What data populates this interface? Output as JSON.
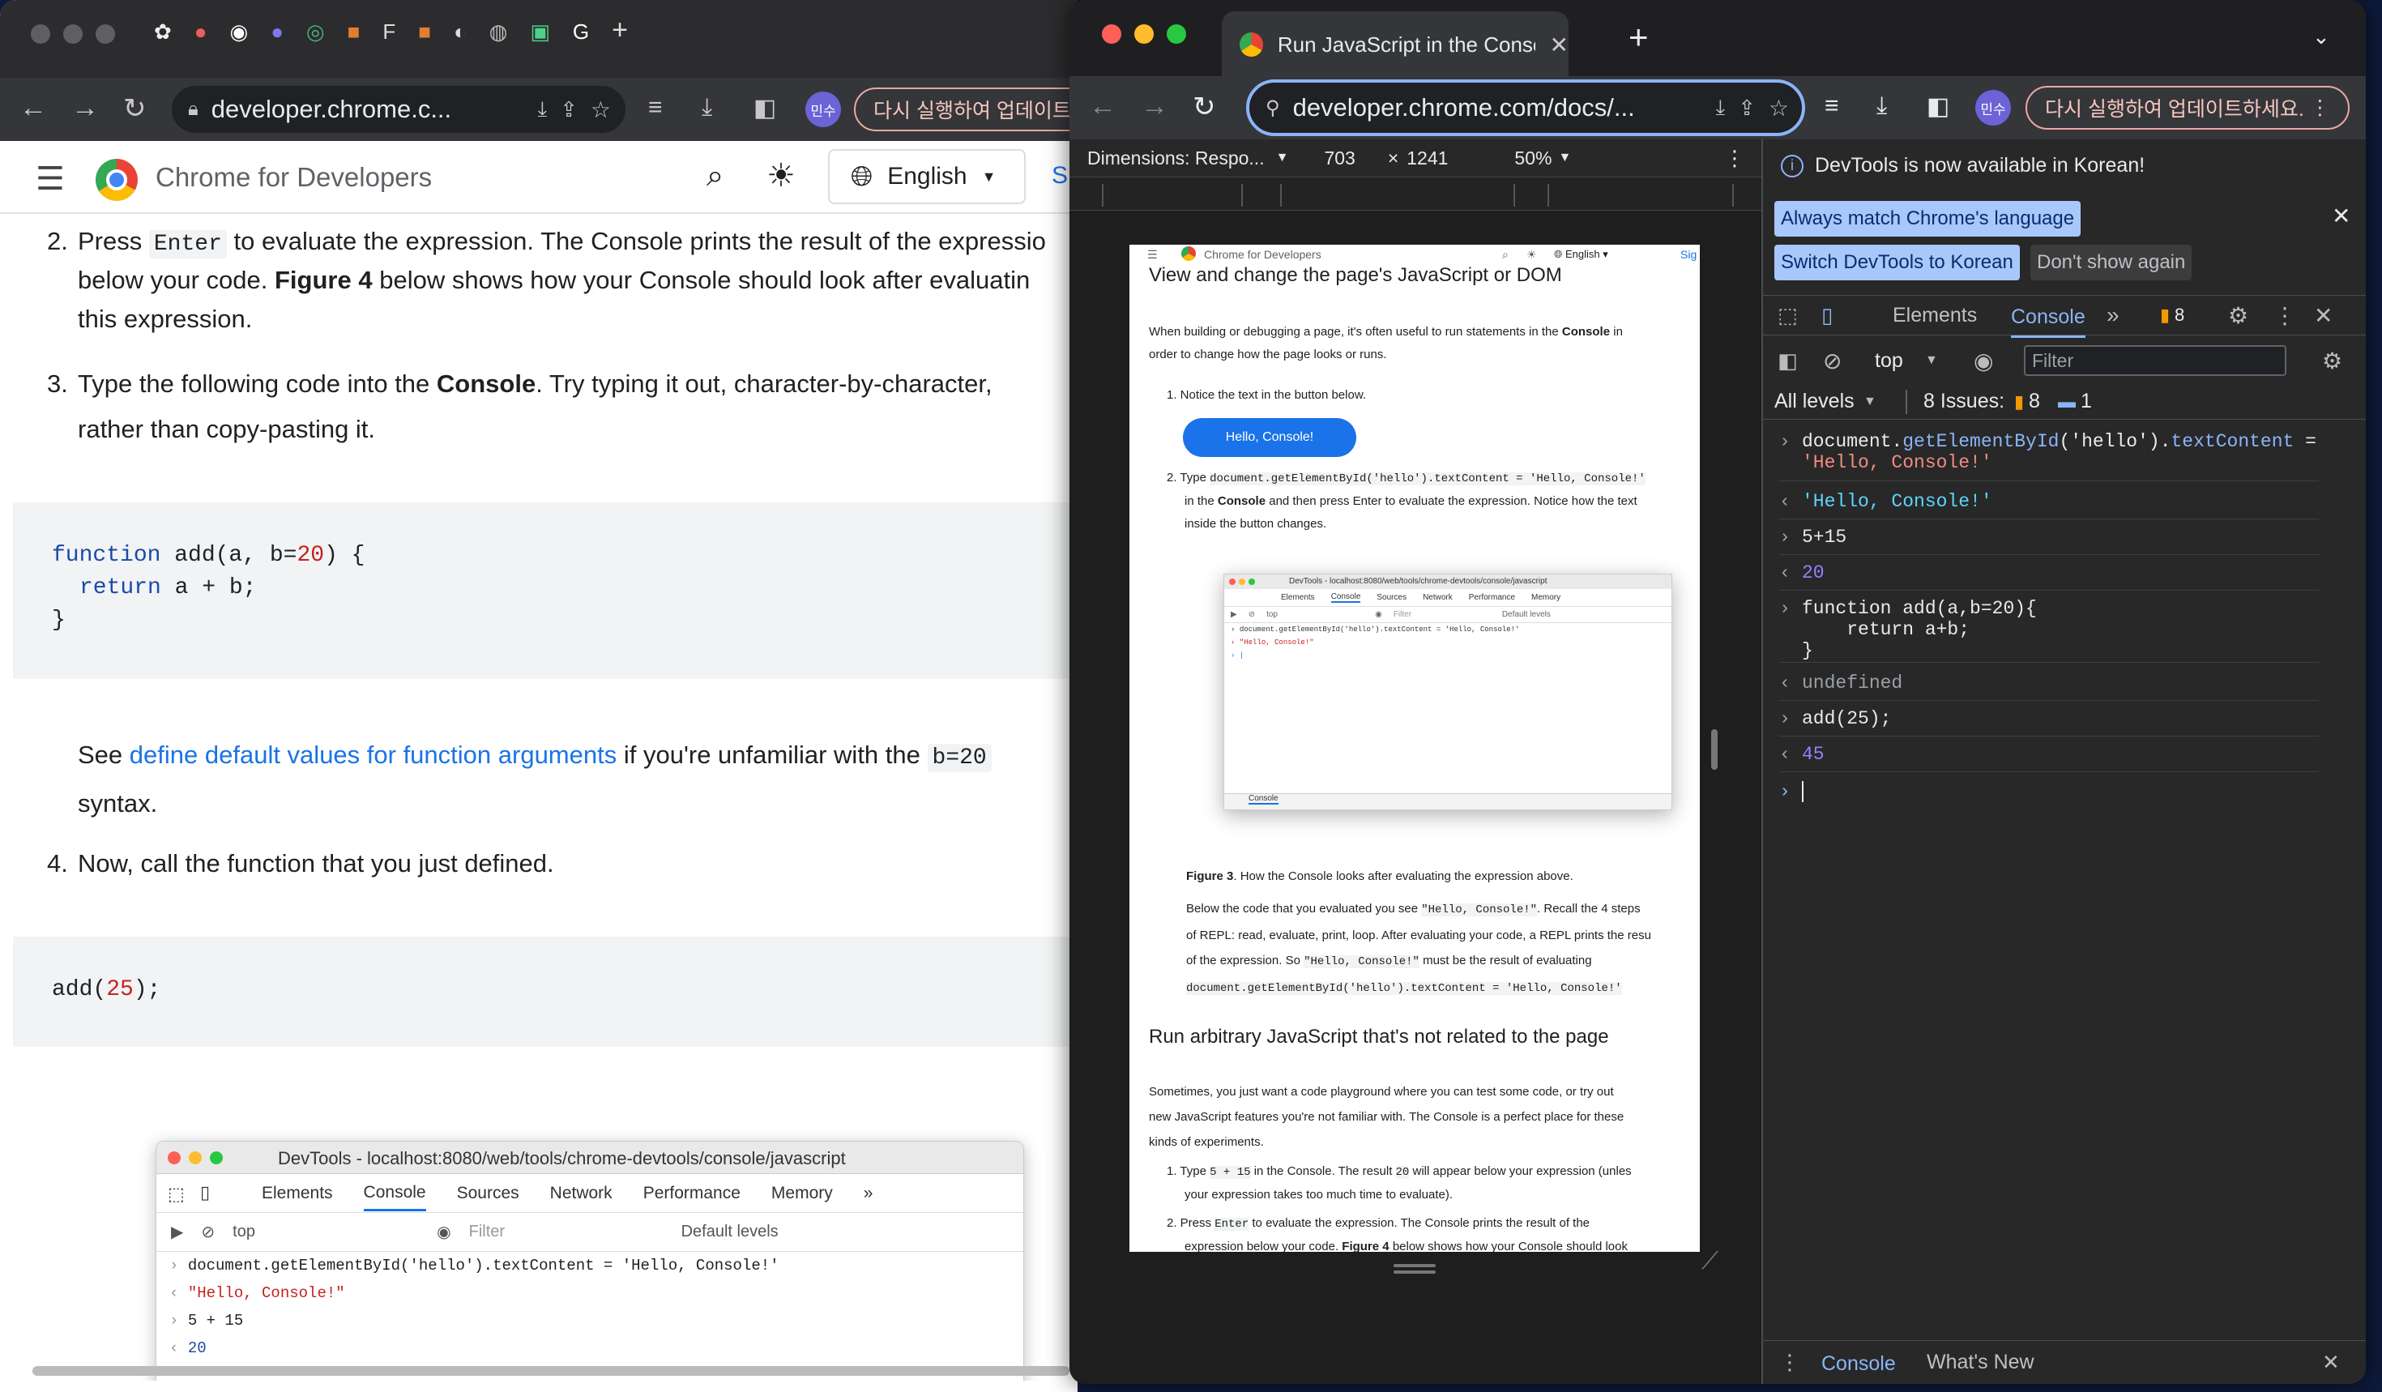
{
  "left_window": {
    "address": "developer.chrome.c...",
    "relaunch": "다시 실행하여 업데이트",
    "avatar": "민수",
    "site_name": "Chrome for Developers",
    "language": "English",
    "signin_partial": "Si",
    "step2": {
      "num": "2.",
      "pre": "Press",
      "code": "Enter",
      "post": "to evaluate the expression. The Console prints the result of the expressio",
      "line2a": "below your code.",
      "fig": "Figure 4",
      "line2b": "below shows how your Console should look after evaluatin",
      "line3": "this expression."
    },
    "step3": {
      "num": "3.",
      "pre": "Type the following code into the",
      "bold": "Console",
      "post": ". Try typing it out, character-by-character,",
      "line2": "rather than copy-pasting it."
    },
    "code1": {
      "l1_kw": "function",
      "l1_a": " add(a, b=",
      "l1_num": "20",
      "l1_b": ") {",
      "l2_kw": "return",
      "l2_rest": " a + b;",
      "l3": "}"
    },
    "see": {
      "pre": "See",
      "link": "define default values for function arguments",
      "mid": "if you're unfamiliar with the",
      "code": "b=20",
      "post": "syntax."
    },
    "step4": {
      "num": "4.",
      "text": "Now, call the function that you just defined."
    },
    "code2": {
      "a": "add(",
      "num": "25",
      "b": ");"
    },
    "fig_window": {
      "title": "DevTools - localhost:8080/web/tools/chrome-devtools/console/javascript",
      "tabs": [
        "Elements",
        "Console",
        "Sources",
        "Network",
        "Performance",
        "Memory"
      ],
      "context": "top",
      "filter_placeholder": "Filter",
      "levels": "Default levels",
      "lines": [
        "document.getElementById('hello').textContent = 'Hello, Console!'",
        "\"Hello, Console!\"",
        "5 + 15",
        "20"
      ]
    }
  },
  "right_window": {
    "tab_title": "Run JavaScript in the Console",
    "address": "developer.chrome.com/docs/...",
    "relaunch": "다시 실행하여 업데이트하세요.",
    "avatar": "민수",
    "device_bar": {
      "dimensions": "Dimensions: Respo...",
      "width": "703",
      "times": "×",
      "height": "1241",
      "zoom": "50%"
    },
    "devtools": {
      "notice": "DevTools is now available in Korean!",
      "btn_match": "Always match Chrome's language",
      "btn_switch": "Switch DevTools to Korean",
      "btn_dont": "Don't show again",
      "tabs": [
        "Elements",
        "Console"
      ],
      "issues_badge": "8",
      "context": "top",
      "filter_placeholder": "Filter",
      "levels": "All levels",
      "issues_label": "8 Issues:",
      "issues_warn": "8",
      "issues_info": "1",
      "drawer_tabs": [
        "Console",
        "What's New"
      ],
      "console": [
        {
          "kind": "in",
          "parts": [
            {
              "t": "document.",
              "c": "#e8eaed"
            },
            {
              "t": "getElementById",
              "c": "#8ab4f8"
            },
            {
              "t": "('hello').",
              "c": "#e8eaed"
            },
            {
              "t": "textContent",
              "c": "#8ab4f8"
            },
            {
              "t": " =",
              "c": "#e8eaed"
            }
          ],
          "cont": "'Hello, Console!'"
        },
        {
          "kind": "out",
          "text": "'Hello, Console!'",
          "color": "#5cd5fb"
        },
        {
          "kind": "in",
          "text": "5+15"
        },
        {
          "kind": "out",
          "text": "20",
          "color": "#9980ff"
        },
        {
          "kind": "in",
          "text": "function add(a,b=20){",
          "l2": "    return a+b;",
          "l3": "}"
        },
        {
          "kind": "out",
          "text": "undefined",
          "color": "#9aa0a6"
        },
        {
          "kind": "in",
          "text": "add(25);"
        },
        {
          "kind": "out",
          "text": "45",
          "color": "#9980ff"
        }
      ]
    },
    "sim_page": {
      "site": "Chrome for Developers",
      "lang": "English",
      "sign": "Sig",
      "heading1": "View and change the page's JavaScript or DOM",
      "p1a": "When building or debugging a page, it's often useful to run statements in the",
      "p1b": "Console",
      "p1c": "in",
      "p1d": "order to change how the page looks or runs.",
      "li1": "1. Notice the text in the button below.",
      "btn": "Hello, Console!",
      "li2a": "2. Type",
      "li2code": "document.getElementById('hello').textContent = 'Hello, Console!'",
      "li2b": "in the",
      "li2bold": "Console",
      "li2c": "and then press Enter to evaluate the expression. Notice how the text",
      "li2d": "inside the button changes.",
      "mini_title": "DevTools - localhost:8080/web/tools/chrome-devtools/console/javascript",
      "mini_tabs": [
        "Elements",
        "Console",
        "Sources",
        "Network",
        "Performance",
        "Memory"
      ],
      "mini_ctx": "top",
      "mini_filter": "Filter",
      "mini_levels": "Default levels",
      "mini_line1": "document.getElementById('hello').textContent = 'Hello, Console!'",
      "mini_line2": "\"Hello, Console!\"",
      "mini_drawer": "Console",
      "fig3a": "Figure 3",
      "fig3b": ". How the Console looks after evaluating the expression above.",
      "p2a": "Below the code that you evaluated you see",
      "p2code": "\"Hello, Console!\"",
      "p2b": ". Recall the 4 steps",
      "p2c": "of REPL: read, evaluate, print, loop. After evaluating your code, a REPL prints the resu",
      "p2d": "of the expression. So",
      "p2code2": "\"Hello, Console!\"",
      "p2e": "must be the result of evaluating",
      "p2code3": "document.getElementById('hello').textContent = 'Hello, Console!'",
      "heading2": "Run arbitrary JavaScript that's not related to the page",
      "p3a": "Sometimes, you just want a code playground where you can test some code, or try out",
      "p3b": "new JavaScript features you're not familiar with. The Console is a perfect place for these",
      "p3c": "kinds of experiments.",
      "l1a": "1. Type",
      "l1code": "5 + 15",
      "l1b": "in the Console. The result",
      "l1code2": "20",
      "l1c": "will appear below your expression (unles",
      "l1d": "your expression takes too much time to evaluate).",
      "l2a": "2. Press",
      "l2code": "Enter",
      "l2b": "to evaluate the expression. The Console prints the result of the",
      "l2c": "expression below your code.",
      "l2bold": "Figure 4",
      "l2d": "below shows how your Console should look"
    }
  }
}
